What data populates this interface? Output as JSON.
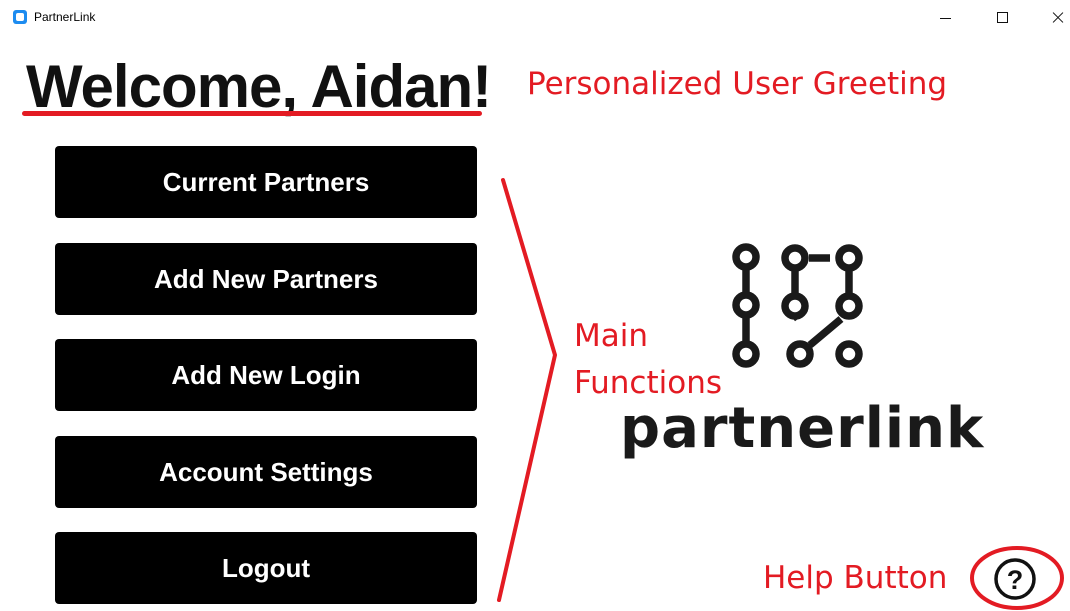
{
  "window": {
    "title": "PartnerLink"
  },
  "header": {
    "greeting": "Welcome, Aidan!"
  },
  "menu": {
    "items": [
      {
        "label": "Current Partners"
      },
      {
        "label": "Add New Partners"
      },
      {
        "label": "Add New Login"
      },
      {
        "label": "Account Settings"
      },
      {
        "label": "Logout"
      }
    ]
  },
  "logo": {
    "wordmark": "partnerlink"
  },
  "help": {
    "symbol": "?"
  },
  "annotations": {
    "greeting": "Personalized User Greeting",
    "main_line1": "Main",
    "main_line2": "Functions",
    "help": "Help Button"
  },
  "colors": {
    "annotation": "#e31b23",
    "button_bg": "#000000",
    "button_text": "#ffffff"
  },
  "icons": [
    "app-icon",
    "minimize-icon",
    "maximize-icon",
    "close-icon",
    "partnerlink-logo-icon",
    "help-icon"
  ]
}
